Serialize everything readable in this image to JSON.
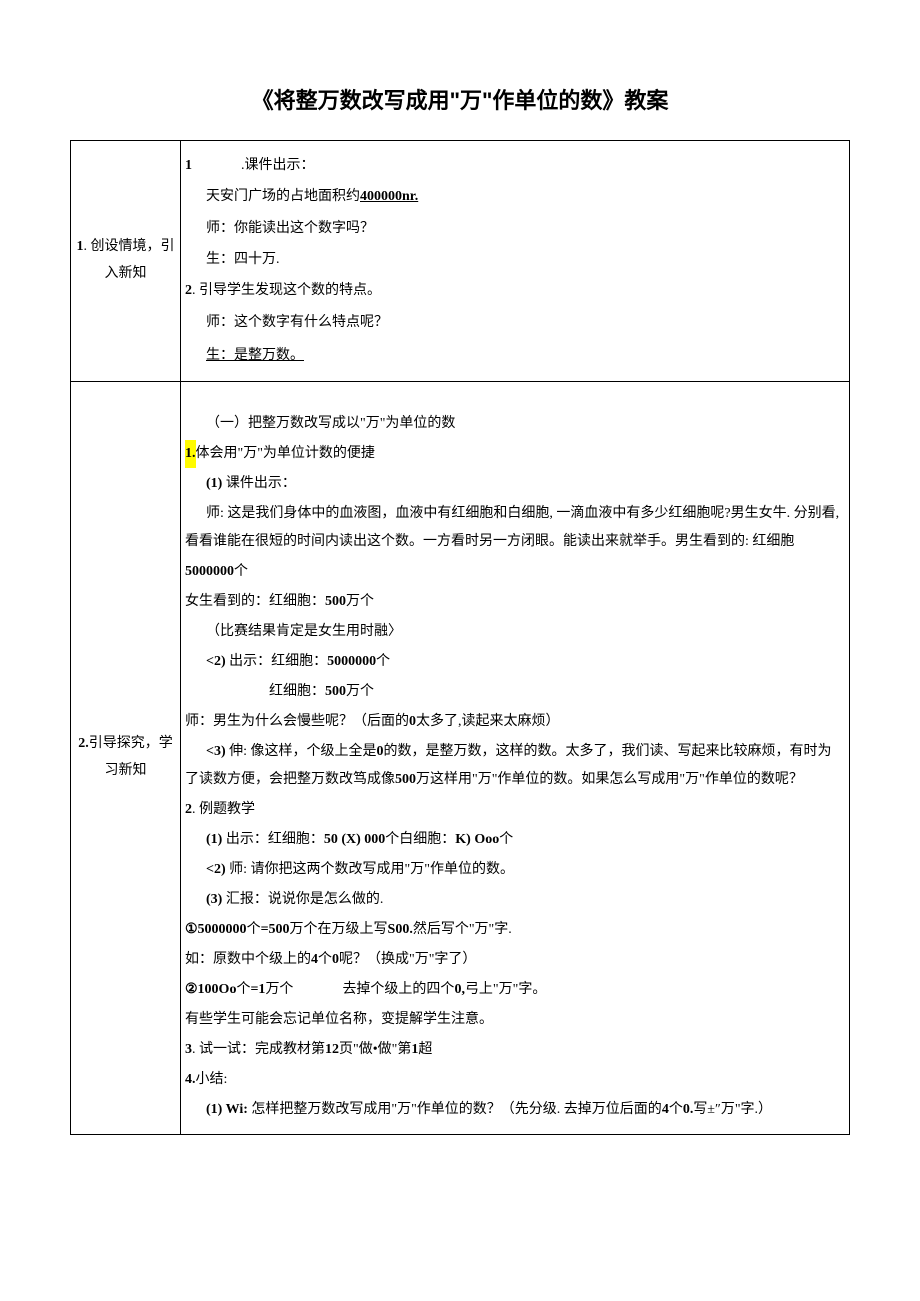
{
  "title": "《将整万数改写成用\"万\"作单位的数》教案",
  "row1": {
    "label": "1. 创设情境，引入新知",
    "lines": {
      "l1a": "1",
      "l1b": ".课件出示：",
      "l2": "天安门广场的占地面积约",
      "l2b": "400000nr.",
      "l3": "师：你能读出这个数字吗？",
      "l4": "生：四十万.",
      "l5a": "2",
      "l5b": ". 引导学生发现这个数的特点。",
      "l6": "师：这个数字有什么特点呢？",
      "l7": "生：是整万数。"
    }
  },
  "row2": {
    "label": "2.引导探究，学习新知",
    "lines": {
      "a1": "（一）把整万数改写成以\"万\"为单位的数",
      "a2a": "1.",
      "a2b": "体会用\"万\"为单位计数的便捷",
      "a3a": "(1)",
      "a3b": " 课件出示：",
      "a4": "师: 这是我们身体中的血液图，血液中有红细胞和白细胞, 一滴血液中有多少红细胞呢?男生女牛. 分别看, 看看谁能在很短的时间内读出这个数。一方看时另一方闭眼。能读出来就举手。男生看到的: 红细胞",
      "a4b": "5000000",
      "a4c": "个",
      "a5a": "女生看到的：红细胞：",
      "a5b": "500",
      "a5c": "万个",
      "a6": "（比赛结果肯定是女生用时融〉",
      "a7a": "<2)",
      "a7b": " 出示：红细胞：",
      "a7c": "5000000",
      "a7d": "个",
      "a8a": "红细胞：",
      "a8b": "500",
      "a8c": "万个",
      "a9a": "师：男生为什么会慢些呢？（后面的",
      "a9b": "0",
      "a9c": "太多了,读起来太麻烦）",
      "a10a": "<3)",
      "a10b": " 伸: 像这样，个级上全是",
      "a10c": "0",
      "a10d": "的数，是整万数，这样的数。太多了，我们读、写起来比较麻烦，有时为了读数方便，会把整万数改笃成像",
      "a10e": "500",
      "a10f": "万这样用\"万\"作单位的数。如果怎么写成用\"万\"作单位的数呢？",
      "b1a": "2",
      "b1b": ". 例题教学",
      "b2a": "(1)",
      "b2b": " 出示：红细胞：",
      "b2c": "50 (X) 000",
      "b2d": "个白细胞：",
      "b2e": "K) Ooo",
      "b2f": "个",
      "b3a": "<2)",
      "b3b": " 师: 请你把这两个数改写成用\"万\"作单位的数。",
      "b4a": "(3)",
      "b4b": " 汇报：说说你是怎么做的.",
      "b5a": "①5000000",
      "b5b": "个",
      "b5c": "=500",
      "b5d": "万个在万级上写",
      "b5e": "S00.",
      "b5f": "然后写个\"万\"字.",
      "b6a": "如：原数中个级上的",
      "b6b": "4",
      "b6c": "个",
      "b6d": "0",
      "b6e": "呢？（换成\"万\"字了）",
      "b7a": "②100Oo",
      "b7b": "个",
      "b7c": "=1",
      "b7d": "万个",
      "b7e": "去掉个级上的四个",
      "b7f": "0,",
      "b7g": "弓上\"万\"字。",
      "b8": "有些学生可能会忘记单位名称，变提解学生注意。",
      "b9a": "3",
      "b9b": ". 试一试：完成教材第",
      "b9c": "12",
      "b9d": "页\"做•做\"第",
      "b9e": "1",
      "b9f": "超",
      "c1a": "4.",
      "c1b": "小结:",
      "c2a": "(1) Wi:",
      "c2b": " 怎样把整万数改写成用\"万\"作单位的数？（先分级. 去掉万位后面的",
      "c2c": "4",
      "c2d": "个",
      "c2e": "0.",
      "c2f": "写±″万\"字.）"
    }
  }
}
